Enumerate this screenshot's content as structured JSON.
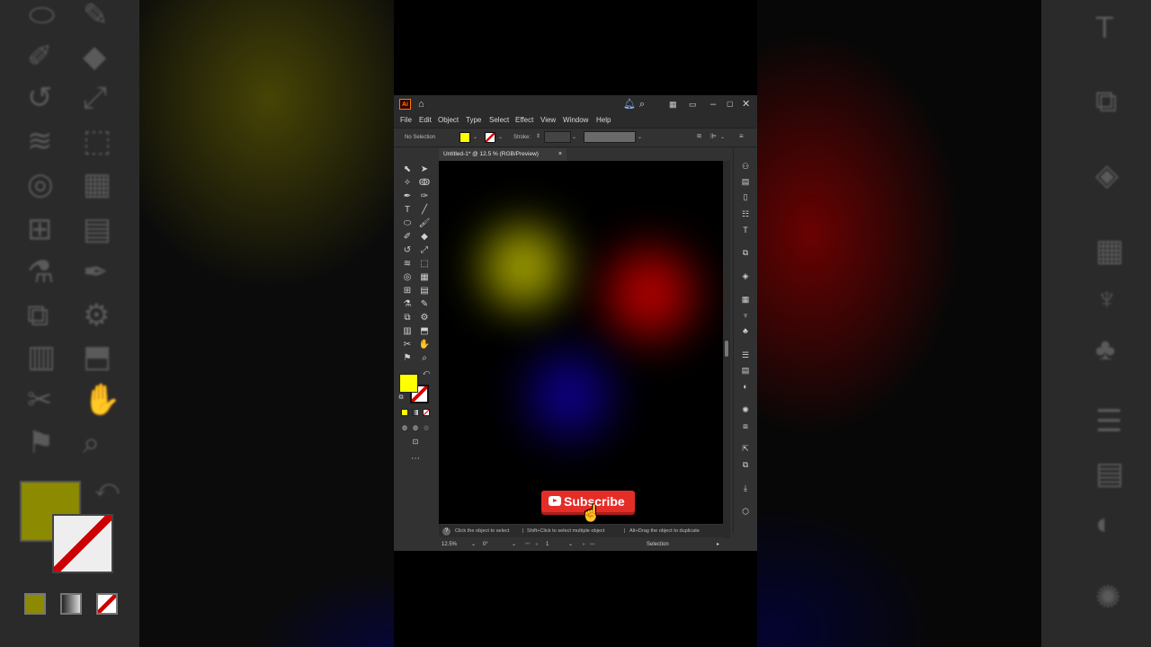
{
  "colors": {
    "accent_fill": "#ffff00",
    "subscribe_red": "#e52d27",
    "panel_bg": "#323232",
    "titlebar_bg": "#2b2b2b"
  },
  "app": {
    "logo": "Ai",
    "menu": [
      "File",
      "Edit",
      "Object",
      "Type",
      "Select",
      "Effect",
      "View",
      "Window",
      "Help"
    ]
  },
  "control_bar": {
    "selection_label": "No Selection",
    "stroke_label": "Stroke:"
  },
  "document": {
    "tab_title": "Untitled-1* @ 12.5 % (RGB/Preview)",
    "tab_close": "×"
  },
  "hints": {
    "text1": "Click the object to select",
    "text2": "Shift+Click to select multiple object",
    "text3": "Alt+Drag the object to duplicate"
  },
  "status": {
    "zoom": "12.5%",
    "rotation": "0°",
    "artboard": "1",
    "tool": "Selection"
  },
  "overlay": {
    "subscribe_label": "Subscribe"
  },
  "icons": {
    "bell": "bell-icon",
    "search": "search-icon",
    "home": "home-icon"
  }
}
